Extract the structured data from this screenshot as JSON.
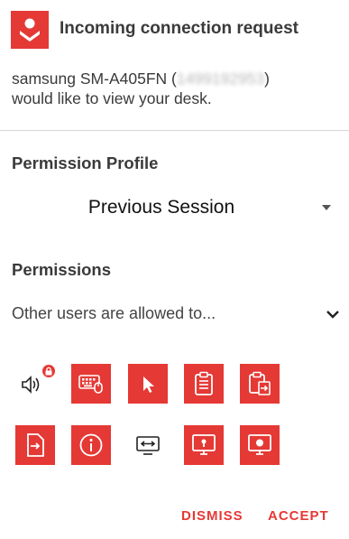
{
  "dialog": {
    "title": "Incoming connection request",
    "message_prefix": "samsung SM-A405FN (",
    "redacted_id": "1499192953",
    "message_suffix": ")",
    "message_line2": "would like to view your desk."
  },
  "profile": {
    "label": "Permission Profile",
    "selected": "Previous Session"
  },
  "permissions": {
    "label": "Permissions",
    "summary": "Other users are allowed to...",
    "icons": [
      "audio-locked-icon",
      "keyboard-mouse-icon",
      "pointer-icon",
      "clipboard-icon",
      "clipboard-transfer-icon",
      "file-transfer-icon",
      "info-icon",
      "restart-icon",
      "lock-screen-icon",
      "record-session-icon"
    ]
  },
  "actions": {
    "dismiss": "DISMISS",
    "accept": "ACCEPT"
  },
  "colors": {
    "accent": "#e53935",
    "text": "#3a3a3a",
    "divider": "#d6d6d6"
  }
}
